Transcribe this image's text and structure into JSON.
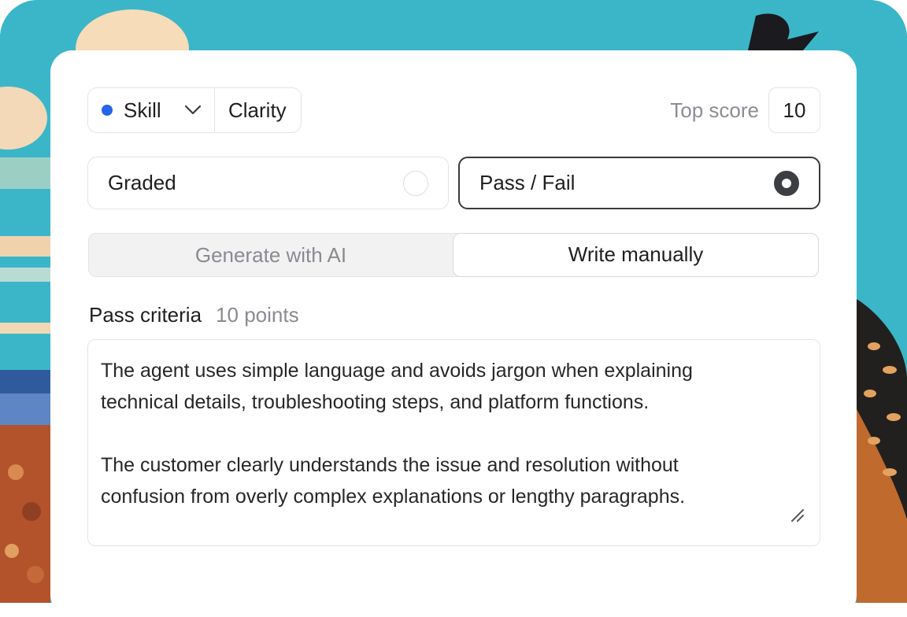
{
  "skill_selector": {
    "label": "Skill",
    "dot_color": "#2563eb",
    "icon": "chevron-down-icon",
    "value": "Clarity"
  },
  "top_score": {
    "label": "Top score",
    "value": "10"
  },
  "grading_mode": {
    "options": [
      {
        "label": "Graded",
        "selected": false
      },
      {
        "label": "Pass / Fail",
        "selected": true
      }
    ]
  },
  "criteria_source": {
    "tabs": [
      {
        "label": "Generate with AI",
        "active": false
      },
      {
        "label": "Write manually",
        "active": true
      }
    ]
  },
  "criteria": {
    "label": "Pass criteria",
    "points": "10 points",
    "paragraphs": [
      [
        "The agent uses simple language and avoids jargon when explaining",
        "technical details, troubleshooting steps, and platform functions."
      ],
      [
        "The customer clearly understands the issue and resolution without",
        "confusion from overly complex explanations or lengthy paragraphs."
      ]
    ]
  }
}
